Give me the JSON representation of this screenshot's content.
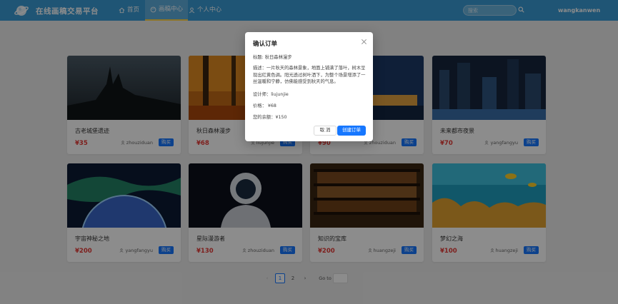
{
  "header": {
    "site_title": "在线画稿交易平台",
    "nav": {
      "home": "首页",
      "market": "画稿中心",
      "user": "个人中心"
    },
    "search_placeholder": "搜索",
    "username": "wangkanwen"
  },
  "cards": [
    {
      "title": "古老城堡遗迹",
      "price": "¥35",
      "author": "zhouziduan",
      "buy": "购买"
    },
    {
      "title": "秋日森林漫步",
      "price": "¥68",
      "author": "liujunjie",
      "buy": "购买"
    },
    {
      "title": "",
      "price": "¥90",
      "author": "zhouziduan",
      "buy": "购买"
    },
    {
      "title": "未来都市夜景",
      "price": "¥70",
      "author": "yangfangyu",
      "buy": "购买"
    },
    {
      "title": "宇宙神秘之地",
      "price": "¥200",
      "author": "yangfangyu",
      "buy": "购买"
    },
    {
      "title": "星际漫游者",
      "price": "¥130",
      "author": "zhouziduan",
      "buy": "购买"
    },
    {
      "title": "知识的宝库",
      "price": "¥200",
      "author": "huangzeji",
      "buy": "购买"
    },
    {
      "title": "梦幻之海",
      "price": "¥100",
      "author": "huangzeji",
      "buy": "购买"
    }
  ],
  "pagination": {
    "prev": "‹",
    "pages": [
      "1",
      "2"
    ],
    "current": "1",
    "next": "›",
    "goto": "Go to"
  },
  "modal": {
    "title": "确认订单",
    "title_line": "标题: 秋日森林漫步",
    "desc_line": "描述：一片秋天的森林景象，地面上铺满了落叶，树木呈现出红黄色调。阳光透过树叶洒下，为整个场景增添了一丝温暖和宁静，仿佛能感受到秋天的气息。",
    "designer_line": "设计师：liujunjie",
    "price_line": "价格： ¥68",
    "balance_line": "您的余额：¥150",
    "cancel": "取 消",
    "confirm": "创建订单"
  },
  "colors": {
    "header": "#3a9bd5",
    "primary": "#1677ff",
    "price": "#e53935",
    "active_underline": "#ffd54a"
  }
}
